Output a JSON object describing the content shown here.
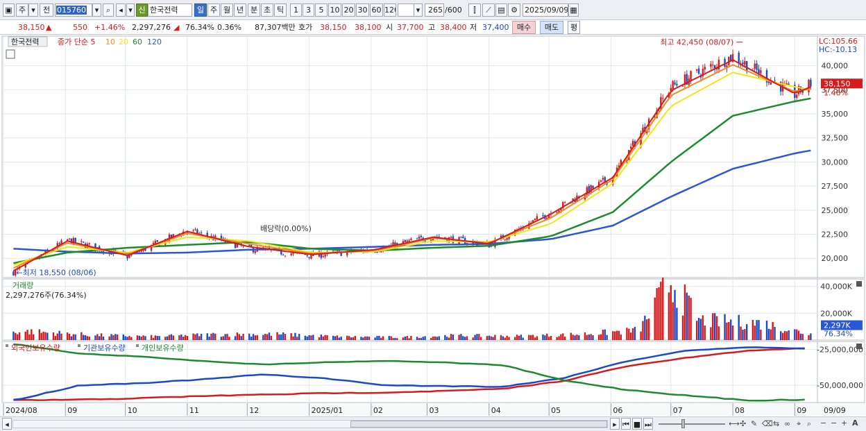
{
  "toolbar": {
    "mode_label": "주",
    "prev_label": "전",
    "code": "015760",
    "stock_name": "한국전력",
    "credit_badge": "신",
    "periods": [
      "일",
      "주",
      "월",
      "년",
      "분",
      "초",
      "틱"
    ],
    "intervals": [
      "1",
      "3",
      "5",
      "10",
      "20",
      "30",
      "60",
      "120"
    ],
    "count": "265",
    "count_total": "/600",
    "date": "2025/09/09"
  },
  "quote": {
    "price": "38,150",
    "change": "550",
    "change_pct": "+1.46%",
    "volume": "2,297,276",
    "vol_ratio": "76.34%",
    "turnover": "0.36%",
    "amount": "87,307백만",
    "hoga_label": "호가",
    "ask": "38,150",
    "bid": "38,100",
    "open_label": "시",
    "open": "37,700",
    "high_label": "고",
    "high": "38,400",
    "low_label": "저",
    "low": "37,400",
    "buy_label": "매수",
    "sell_label": "매도",
    "avg_label": "평"
  },
  "price_panel": {
    "name": "한국전력",
    "ma_title": "종가 단순",
    "ma_periods": [
      "5",
      "10",
      "20",
      "60",
      "120"
    ],
    "max_label": "최고 42,450 (08/07)",
    "min_label": "최저 18,550 (08/06)",
    "dividend_label": "배당락(0.00%)",
    "lc_label": "LC:105.66",
    "hc_label": "HC:-10.13",
    "cur_price": "38,150",
    "cur_pct": "1.46%"
  },
  "volume_panel": {
    "title": "거래량",
    "info": "2,297,276주(76.34%)",
    "cur_label": "2,297K",
    "cur_pct": "76.34%"
  },
  "holding_panel": {
    "legends": [
      "외국인보유수량",
      "기관보유수량",
      "개인보유수량"
    ]
  },
  "date_labels": [
    "2024/08",
    "09",
    "10",
    "11",
    "12",
    "2025/01",
    "02",
    "03",
    "04",
    "05",
    "06",
    "07",
    "08",
    "09"
  ],
  "last_date": "09/09",
  "colors": {
    "up": "#d51b1b",
    "down": "#1b49c8",
    "ma5": "#d51b1b",
    "ma10": "#ef8a1c",
    "ma20": "#f2e615",
    "ma60": "#1d8a2e",
    "ma120": "#2b57d6"
  },
  "chart_data": [
    {
      "type": "candlestick",
      "title": "한국전력",
      "ylim": [
        18000,
        43000
      ],
      "yticks": [
        "20,000",
        "22,500",
        "25,000",
        "27,500",
        "30,000",
        "32,500",
        "35,000",
        "37,500",
        "40,000"
      ],
      "x": [
        "2024/08/06",
        "2024/09/02",
        "2024/10/02",
        "2024/11/01",
        "2024/12/02",
        "2025/01/02",
        "2025/02/03",
        "2025/03/04",
        "2025/04/01",
        "2025/05/02",
        "2025/06/02",
        "2025/07/01",
        "2025/08/01",
        "2025/09/01",
        "2025/09/09"
      ],
      "close": [
        18550,
        21900,
        20200,
        22900,
        21000,
        20300,
        20900,
        22300,
        21400,
        24800,
        28500,
        37800,
        41000,
        37000,
        38150
      ],
      "series": [
        {
          "name": "5",
          "values": [
            18700,
            21800,
            20300,
            22800,
            21200,
            20400,
            20900,
            22200,
            21500,
            24600,
            28400,
            37400,
            40600,
            37100,
            37800
          ]
        },
        {
          "name": "10",
          "values": [
            19000,
            21600,
            20400,
            22600,
            21500,
            20500,
            20800,
            22100,
            21600,
            24200,
            28200,
            36900,
            40100,
            37300,
            37600
          ]
        },
        {
          "name": "20",
          "values": [
            19300,
            21200,
            20600,
            22200,
            21800,
            20600,
            20700,
            21800,
            21700,
            23600,
            27800,
            35800,
            39300,
            37800,
            37500
          ]
        },
        {
          "name": "60",
          "values": [
            19500,
            20600,
            21100,
            21400,
            21700,
            21000,
            20800,
            21100,
            21300,
            22300,
            24800,
            30000,
            34800,
            36300,
            36600
          ]
        },
        {
          "name": "120",
          "values": [
            21000,
            20700,
            20500,
            20600,
            20900,
            21000,
            21200,
            21400,
            21500,
            22000,
            23400,
            26400,
            29300,
            30900,
            31200
          ]
        }
      ]
    },
    {
      "type": "bar",
      "title": "거래량",
      "ylim": [
        0,
        45000
      ],
      "yticks": [
        "20,000K",
        "40,000K"
      ],
      "x": [
        "2024/08",
        "2024/09",
        "2024/10",
        "2024/11",
        "2024/12",
        "2025/01",
        "2025/02",
        "2025/03",
        "2025/04",
        "2025/05",
        "2025/06",
        "2025/07/01",
        "2025/07",
        "2025/08",
        "2025/09"
      ],
      "values": [
        6000,
        3500,
        2500,
        4000,
        4200,
        2500,
        2000,
        3200,
        2800,
        4000,
        7000,
        42000,
        14000,
        12000,
        2297
      ]
    },
    {
      "type": "line",
      "title": "보유수량",
      "ylim": [
        -62000000,
        -20000000
      ],
      "yticks": [
        "-25,000,000",
        "-50,000,000"
      ],
      "x": [
        "2024/08",
        "2024/09",
        "2024/10",
        "2024/11",
        "2024/12",
        "2025/01",
        "2025/02",
        "2025/03",
        "2025/04",
        "2025/05",
        "2025/06",
        "2025/07",
        "2025/08",
        "2025/09"
      ],
      "series": [
        {
          "name": "외국인보유수량",
          "values": [
            -60500000,
            -60000000,
            -59000000,
            -57500000,
            -56500000,
            -55500000,
            -55000000,
            -54000000,
            -52500000,
            -47000000,
            -37000000,
            -31000000,
            -26000000,
            -24000000
          ]
        },
        {
          "name": "기관보유수량",
          "values": [
            -60000000,
            -50000000,
            -48500000,
            -46000000,
            -42500000,
            -45000000,
            -50000000,
            -50500000,
            -51000000,
            -45000000,
            -33500000,
            -26000000,
            -23500000,
            -24500000
          ]
        },
        {
          "name": "개인보유수량",
          "values": [
            -21500000,
            -28000000,
            -30000000,
            -33000000,
            -35500000,
            -34000000,
            -33000000,
            -34000000,
            -36000000,
            -46500000,
            -53000000,
            -57000000,
            -60500000,
            -60000000
          ]
        }
      ]
    }
  ]
}
